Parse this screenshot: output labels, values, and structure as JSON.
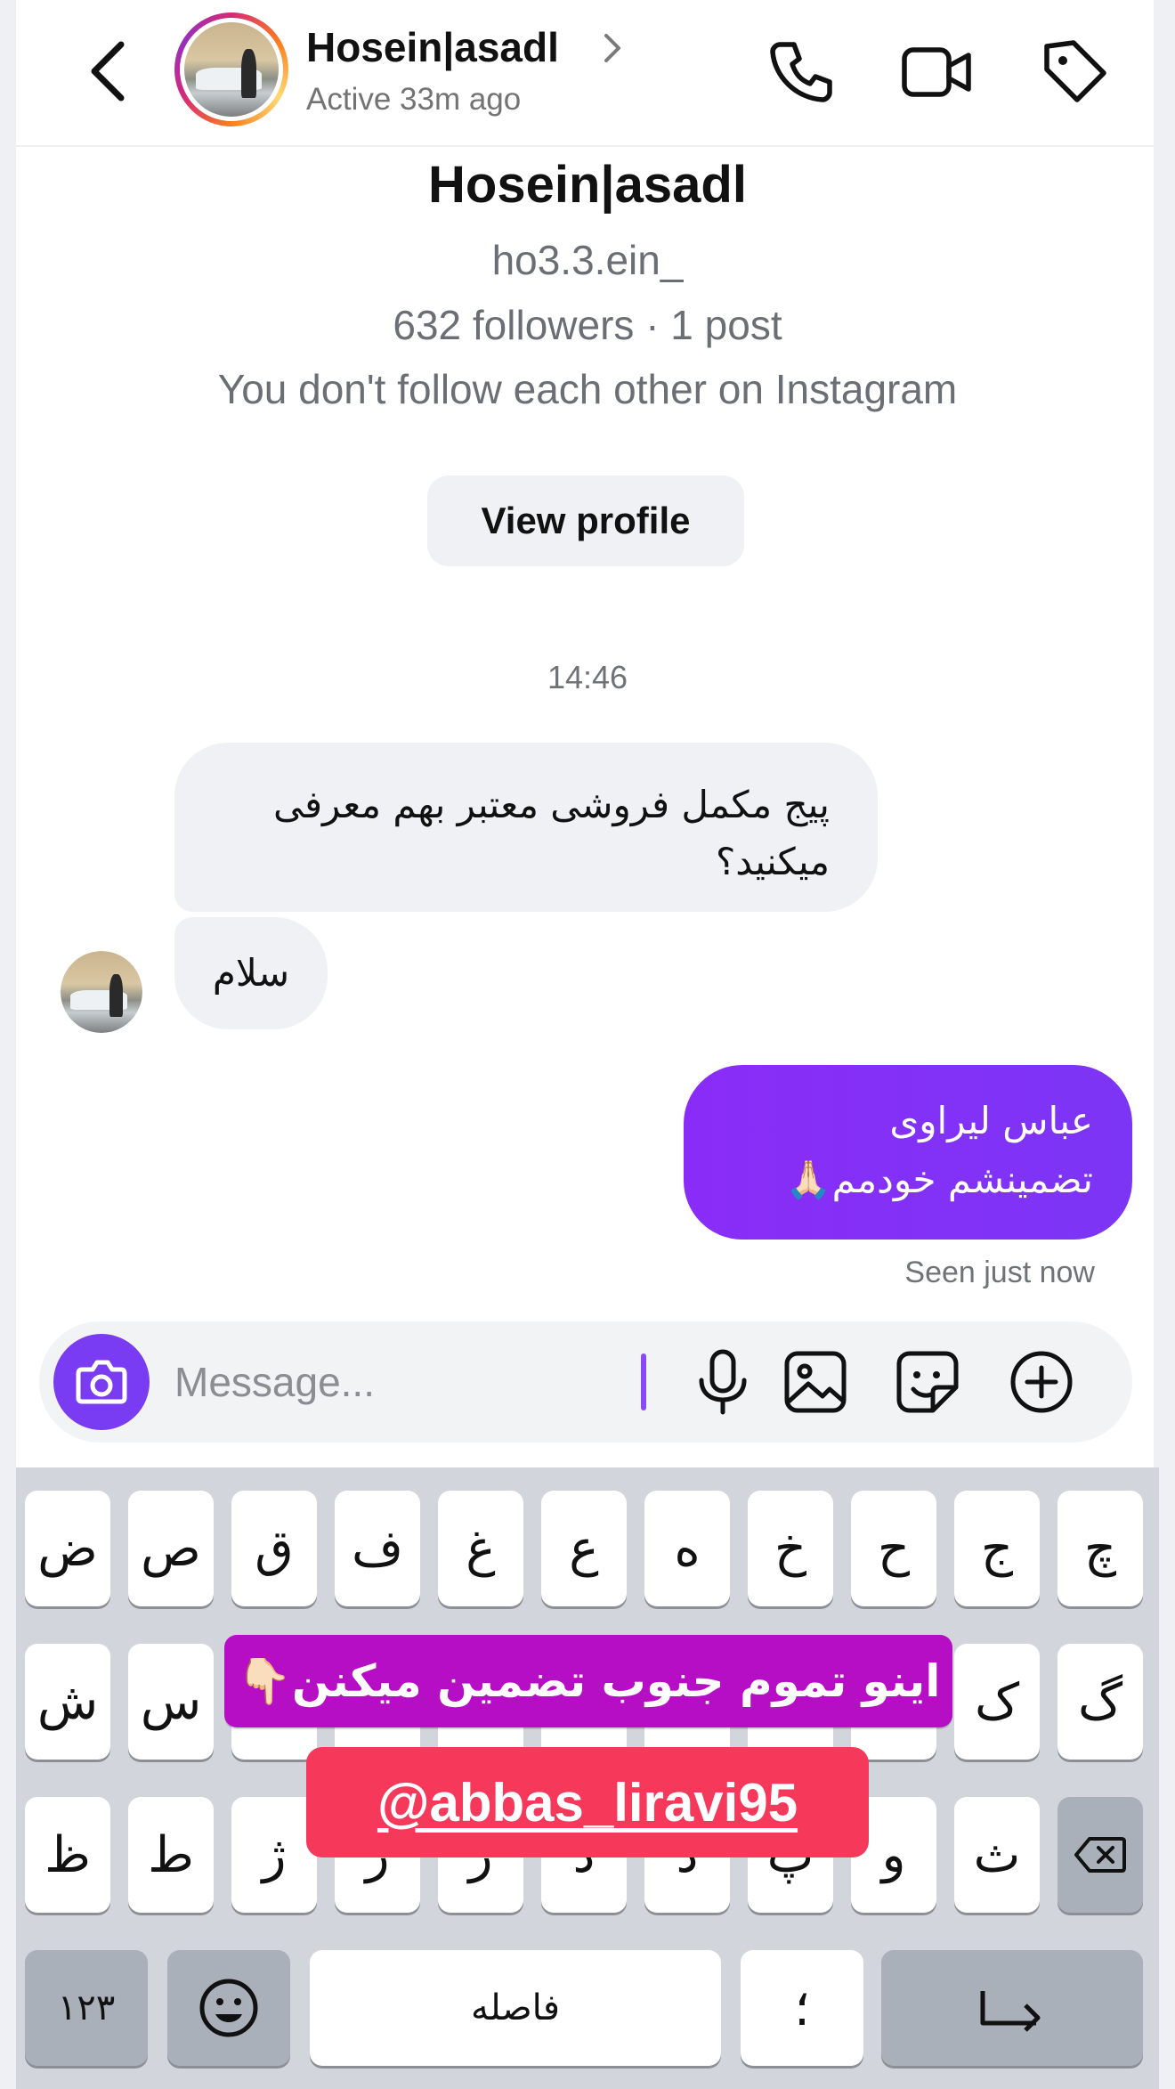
{
  "header": {
    "name": "Hosein|asadl",
    "status": "Active 33m ago"
  },
  "profile": {
    "name": "Hosein|asadl",
    "handle": "ho3.3.ein_",
    "stats": "632 followers · 1 post",
    "note": "You don't follow each other on Instagram",
    "view_button": "View profile"
  },
  "chat": {
    "timestamp": "14:46",
    "incoming": [
      {
        "text": "پیج مکمل فروشی معتبر بهم معرفی میکنید؟"
      },
      {
        "text": "سلام"
      }
    ],
    "outgoing": {
      "line1": "عباس لیراوی",
      "line2": "تضمینشم خودمم🙏🏻"
    },
    "seen": "Seen just now"
  },
  "composer": {
    "placeholder": "Message..."
  },
  "keyboard": {
    "row1": [
      "ض",
      "ص",
      "ق",
      "ف",
      "غ",
      "ع",
      "ه",
      "خ",
      "ح",
      "ج",
      "چ"
    ],
    "row2": [
      "ش",
      "س",
      "",
      "",
      "",
      "",
      "",
      "",
      "",
      "ک",
      "گ"
    ],
    "row3": [
      "ظ",
      "ط",
      "ژ",
      "ر",
      "ز",
      "د",
      "ذ",
      "پ",
      "و",
      "ث"
    ],
    "numbers_key": "۱۲۳",
    "space_key": "فاصله",
    "punct_key": "؛"
  },
  "overlays": {
    "caption": "اینو تموم جنوب تضمین میکنن👇🏻",
    "mention": "@abbas_liravi95"
  },
  "colors": {
    "accent": "#7a3cf2",
    "outgoing_bubble": "#8a2cf7",
    "caption_bg": "#b60ec4",
    "mention_bg": "#f6395a"
  }
}
